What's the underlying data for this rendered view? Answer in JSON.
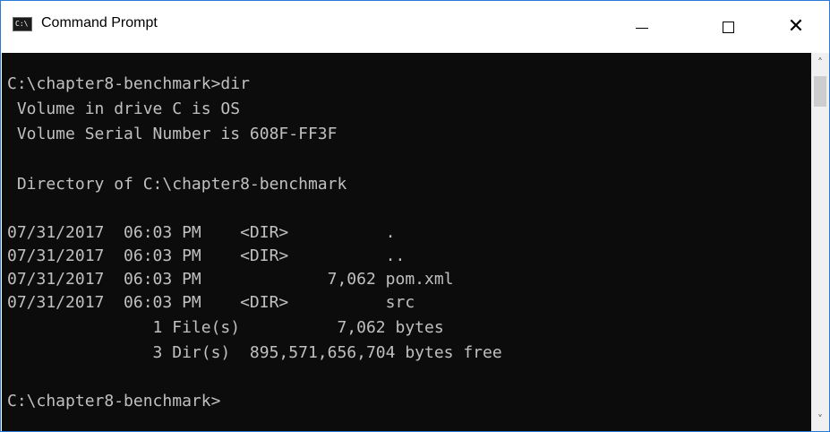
{
  "window": {
    "title": "Command Prompt",
    "icon_label": "C:\\",
    "controls": {
      "minimize": "minimize-icon",
      "maximize": "maximize-icon",
      "close": "close-icon"
    }
  },
  "console": {
    "lines": [
      "C:\\chapter8-benchmark>dir",
      " Volume in drive C is OS",
      " Volume Serial Number is 608F-FF3F",
      "",
      " Directory of C:\\chapter8-benchmark",
      "",
      "07/31/2017  06:03 PM    <DIR>          .",
      "07/31/2017  06:03 PM    <DIR>          ..",
      "07/31/2017  06:03 PM             7,062 pom.xml",
      "07/31/2017  06:03 PM    <DIR>          src",
      "               1 File(s)          7,062 bytes",
      "               3 Dir(s)  895,571,656,704 bytes free",
      "",
      "C:\\chapter8-benchmark>"
    ]
  },
  "colors": {
    "console_bg": "#0c0c0c",
    "console_fg": "#c0c0c0",
    "titlebar_bg": "#ffffff",
    "border": "#2b79d8"
  }
}
